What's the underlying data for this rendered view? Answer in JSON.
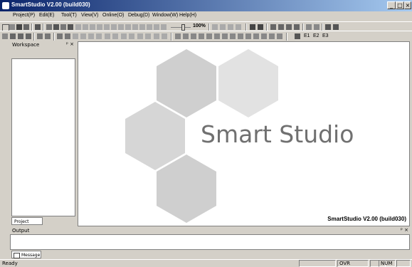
{
  "window": {
    "title": "SmartStudio V2.00 (build030)",
    "buttons": {
      "minimize": "_",
      "maximize": "□",
      "close": "×"
    }
  },
  "menu": {
    "items": [
      "Project(P)",
      "Edit(E)",
      "Tool(T)",
      "View(V)",
      "Online(O)",
      "Debug(D)",
      "Window(W)",
      "Help(H)"
    ]
  },
  "toolbar": {
    "zoom": "100%",
    "elements": [
      "E1",
      "E2",
      "E3"
    ]
  },
  "workspace": {
    "title": "Workspace",
    "controls": "ᵖ ×",
    "tab_label": "Project"
  },
  "canvas": {
    "brand_text": "Smart Studio",
    "version_text": "SmartStudio V2.00 (build030)",
    "colors": {
      "hex_dark": "#cfcfcf",
      "hex_light": "#e2e2e2",
      "brand": "#707070"
    }
  },
  "output": {
    "title": "Output",
    "controls": "ᵖ ×",
    "tab_label": "Message"
  },
  "status": {
    "ready": "Ready",
    "ovr": "OVR",
    "num": "NUM"
  }
}
